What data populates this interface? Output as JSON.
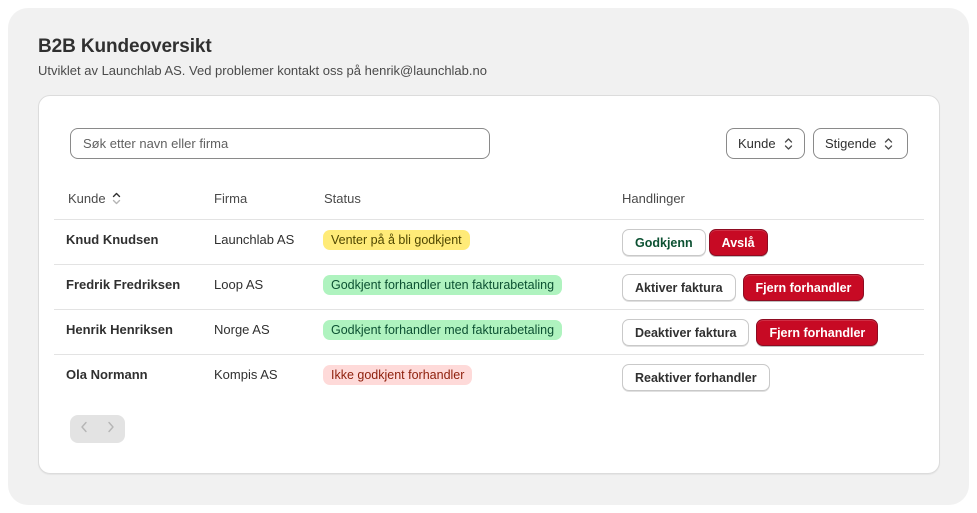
{
  "header": {
    "title": "B2B Kundeoversikt",
    "subtitle": "Utviklet av Launchlab AS. Ved problemer kontakt oss på henrik@launchlab.no"
  },
  "toolbar": {
    "search_placeholder": "Søk etter navn eller firma",
    "search_value": "",
    "sort_field": "Kunde",
    "sort_order": "Stigende"
  },
  "table": {
    "columns": {
      "customer": "Kunde",
      "company": "Firma",
      "status": "Status",
      "actions": "Handlinger"
    },
    "rows": [
      {
        "name": "Knud Knudsen",
        "company": "Launchlab AS",
        "status": "Venter på å bli godkjent",
        "status_tone": "warning",
        "actions": [
          "Godkjenn",
          "Avslå"
        ]
      },
      {
        "name": "Fredrik Fredriksen",
        "company": "Loop AS",
        "status": "Godkjent forhandler uten fakturabetaling",
        "status_tone": "success",
        "actions": [
          "Aktiver faktura",
          "Fjern forhandler"
        ]
      },
      {
        "name": "Henrik Henriksen",
        "company": "Norge AS",
        "status": "Godkjent forhandler med fakturabetaling",
        "status_tone": "success",
        "actions": [
          "Deaktiver faktura",
          "Fjern forhandler"
        ]
      },
      {
        "name": "Ola Normann",
        "company": "Kompis AS",
        "status": "Ikke godkjent forhandler",
        "status_tone": "critical",
        "actions": [
          "Reaktiver forhandler"
        ]
      }
    ]
  },
  "pagination": {
    "prev_icon": "chevron-left-icon",
    "next_icon": "chevron-right-icon",
    "prev_enabled": false,
    "next_enabled": false
  },
  "colors": {
    "danger": "#c70a24",
    "success_badge": "#aff3bf",
    "warning_badge": "#ffeb78",
    "critical_badge": "#fedad9"
  }
}
